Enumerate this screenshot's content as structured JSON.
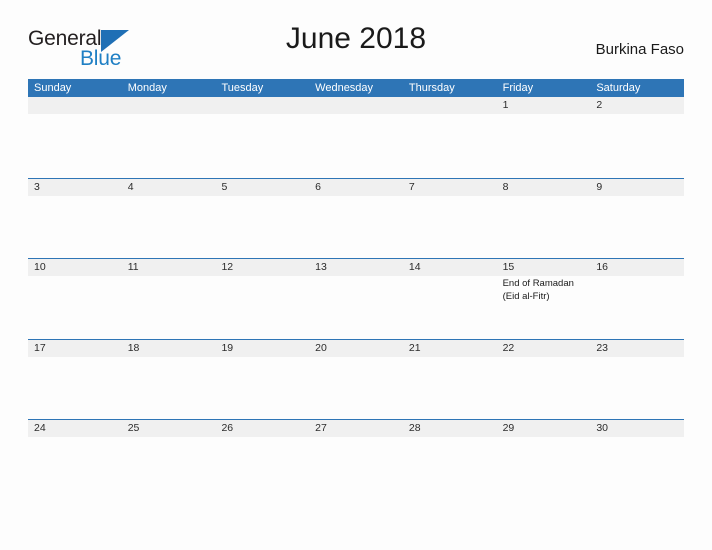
{
  "brand": {
    "name_top": "General",
    "name_bottom": "Blue",
    "flag_icon": "flag-triangle-icon",
    "accent_color": "#1f7fc4"
  },
  "header": {
    "title": "June 2018",
    "country": "Burkina Faso"
  },
  "colors": {
    "header_blue": "#2e75b6",
    "band_gray": "#f0f0f0",
    "text": "#2b2b2b",
    "page_background": "#fdfdfd"
  },
  "calendar": {
    "weekdays": [
      "Sunday",
      "Monday",
      "Tuesday",
      "Wednesday",
      "Thursday",
      "Friday",
      "Saturday"
    ],
    "weeks": [
      [
        {
          "day": "",
          "event": ""
        },
        {
          "day": "",
          "event": ""
        },
        {
          "day": "",
          "event": ""
        },
        {
          "day": "",
          "event": ""
        },
        {
          "day": "",
          "event": ""
        },
        {
          "day": "1",
          "event": ""
        },
        {
          "day": "2",
          "event": ""
        }
      ],
      [
        {
          "day": "3",
          "event": ""
        },
        {
          "day": "4",
          "event": ""
        },
        {
          "day": "5",
          "event": ""
        },
        {
          "day": "6",
          "event": ""
        },
        {
          "day": "7",
          "event": ""
        },
        {
          "day": "8",
          "event": ""
        },
        {
          "day": "9",
          "event": ""
        }
      ],
      [
        {
          "day": "10",
          "event": ""
        },
        {
          "day": "11",
          "event": ""
        },
        {
          "day": "12",
          "event": ""
        },
        {
          "day": "13",
          "event": ""
        },
        {
          "day": "14",
          "event": ""
        },
        {
          "day": "15",
          "event": "End of Ramadan\n(Eid al-Fitr)"
        },
        {
          "day": "16",
          "event": ""
        }
      ],
      [
        {
          "day": "17",
          "event": ""
        },
        {
          "day": "18",
          "event": ""
        },
        {
          "day": "19",
          "event": ""
        },
        {
          "day": "20",
          "event": ""
        },
        {
          "day": "21",
          "event": ""
        },
        {
          "day": "22",
          "event": ""
        },
        {
          "day": "23",
          "event": ""
        }
      ],
      [
        {
          "day": "24",
          "event": ""
        },
        {
          "day": "25",
          "event": ""
        },
        {
          "day": "26",
          "event": ""
        },
        {
          "day": "27",
          "event": ""
        },
        {
          "day": "28",
          "event": ""
        },
        {
          "day": "29",
          "event": ""
        },
        {
          "day": "30",
          "event": ""
        }
      ]
    ]
  }
}
